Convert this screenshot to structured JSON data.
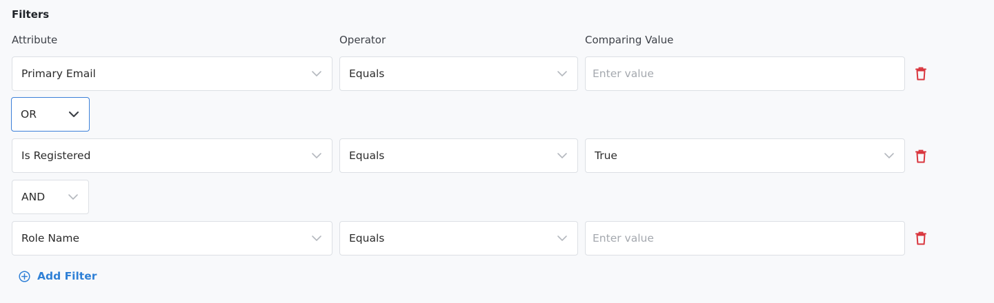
{
  "section": {
    "title": "Filters"
  },
  "columns": {
    "attribute": "Attribute",
    "operator": "Operator",
    "value": "Comparing Value"
  },
  "rows": [
    {
      "attribute": "Primary Email",
      "operator": "Equals",
      "value": "",
      "value_placeholder": "Enter value",
      "value_type": "input"
    },
    {
      "attribute": "Is Registered",
      "operator": "Equals",
      "value": "True",
      "value_type": "select"
    },
    {
      "attribute": "Role Name",
      "operator": "Equals",
      "value": "",
      "value_placeholder": "Enter value",
      "value_type": "input"
    }
  ],
  "connectors": [
    {
      "label": "OR",
      "focused": true
    },
    {
      "label": "AND",
      "focused": false
    }
  ],
  "actions": {
    "add_filter": "Add Filter"
  },
  "icons": {
    "delete": "trash-icon",
    "dropdown": "chevron-down-icon",
    "add": "circle-plus-icon"
  },
  "colors": {
    "accent": "#2f80d6",
    "delete": "#d9363e",
    "focus_border": "#3a7fd8"
  }
}
